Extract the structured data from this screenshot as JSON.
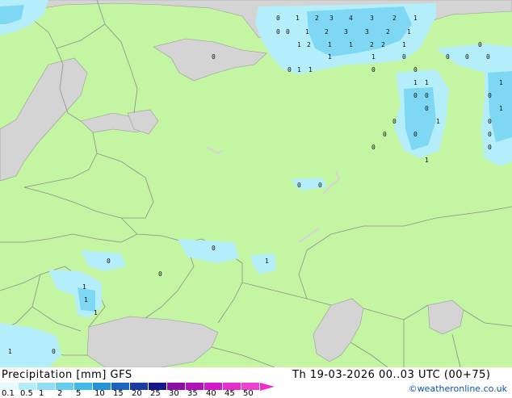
{
  "title": "Precipitation [mm]",
  "model": "GFS",
  "valid_time": "Th 19-03-2026 00..03 UTC (00+75)",
  "credit": "©weatheronline.co.uk",
  "colors": {
    "land": "#c4f5a2",
    "non_forecast_land": "#d4d4d4",
    "border": "#8e8e8e",
    "precip_light": "#b5eefb",
    "precip_medium": "#7fd8f3"
  },
  "legend": {
    "labels": [
      "0.1",
      "0.5",
      "1",
      "2",
      "5",
      "10",
      "15",
      "20",
      "25",
      "30",
      "35",
      "40",
      "45",
      "50"
    ],
    "colors": [
      "#e6fbfe",
      "#b5eefb",
      "#8fdff4",
      "#65cdee",
      "#3fb9e6",
      "#2394d8",
      "#1c64c2",
      "#1a3aa4",
      "#16168c",
      "#8e0fa8",
      "#b412ba",
      "#d21ac8",
      "#e62ecc",
      "#ee40d2"
    ]
  },
  "grid_values": [
    {
      "t": "0"
    },
    {
      "t": "1"
    },
    {
      "t": "2"
    },
    {
      "t": "3"
    },
    {
      "t": "4"
    },
    {
      "t": "3"
    },
    {
      "t": "2"
    },
    {
      "t": "1"
    },
    {
      "t": "0"
    },
    {
      "t": "0"
    },
    {
      "t": "1"
    },
    {
      "t": "2"
    },
    {
      "t": "3"
    },
    {
      "t": "3"
    },
    {
      "t": "2"
    },
    {
      "t": "1"
    },
    {
      "t": "1"
    },
    {
      "t": "2"
    },
    {
      "t": "1"
    },
    {
      "t": "1"
    },
    {
      "t": "2"
    },
    {
      "t": "2"
    },
    {
      "t": "1"
    },
    {
      "t": "0"
    },
    {
      "t": "0"
    },
    {
      "t": "1"
    },
    {
      "t": "1"
    },
    {
      "t": "0"
    },
    {
      "t": "0"
    },
    {
      "t": "0"
    },
    {
      "t": "0"
    },
    {
      "t": "0"
    },
    {
      "t": "1"
    },
    {
      "t": "1"
    },
    {
      "t": "0"
    },
    {
      "t": "0"
    },
    {
      "t": "1"
    },
    {
      "t": "1"
    },
    {
      "t": "1"
    },
    {
      "t": "0"
    },
    {
      "t": "0"
    },
    {
      "t": "0"
    },
    {
      "t": "1"
    },
    {
      "t": "0"
    },
    {
      "t": "1"
    },
    {
      "t": "0"
    },
    {
      "t": "0"
    },
    {
      "t": "0"
    },
    {
      "t": "0"
    },
    {
      "t": "0"
    },
    {
      "t": "0"
    },
    {
      "t": "0"
    },
    {
      "t": "1"
    },
    {
      "t": "0"
    },
    {
      "t": "0"
    },
    {
      "t": "1"
    },
    {
      "t": "1"
    },
    {
      "t": "0"
    },
    {
      "t": "0"
    },
    {
      "t": "1"
    },
    {
      "t": "1"
    },
    {
      "t": "0"
    },
    {
      "t": "0"
    },
    {
      "t": "1"
    }
  ]
}
